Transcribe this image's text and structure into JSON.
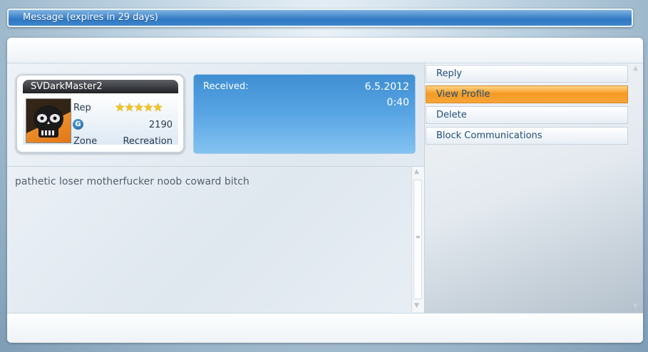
{
  "window": {
    "title": "Message (expires in 29 days)"
  },
  "sender": {
    "gamertag": "SVDarkMaster2",
    "rep_label": "Rep",
    "rep_stars": 5,
    "stars_text": "★★★★★",
    "gamerscore_icon": "G",
    "gamerscore": "2190",
    "zone_label": "Zone",
    "zone": "Recreation"
  },
  "received": {
    "label": "Received:",
    "date": "6.5.2012",
    "time": "0:40"
  },
  "message": {
    "body": "pathetic loser motherfucker noob coward bitch"
  },
  "actions": [
    {
      "label": "Reply"
    },
    {
      "label": "View Profile"
    },
    {
      "label": "Delete"
    },
    {
      "label": "Block Communications"
    }
  ],
  "colors": {
    "accent_orange": "#f59a21",
    "title_blue": "#2f78c3",
    "received_blue": "#4a9ad9"
  },
  "icons": {
    "avatar": "skull-avatar-icon",
    "gamerscore": "gamerscore-icon",
    "scroll_up": "chevron-up-icon",
    "scroll_down": "chevron-down-icon"
  }
}
